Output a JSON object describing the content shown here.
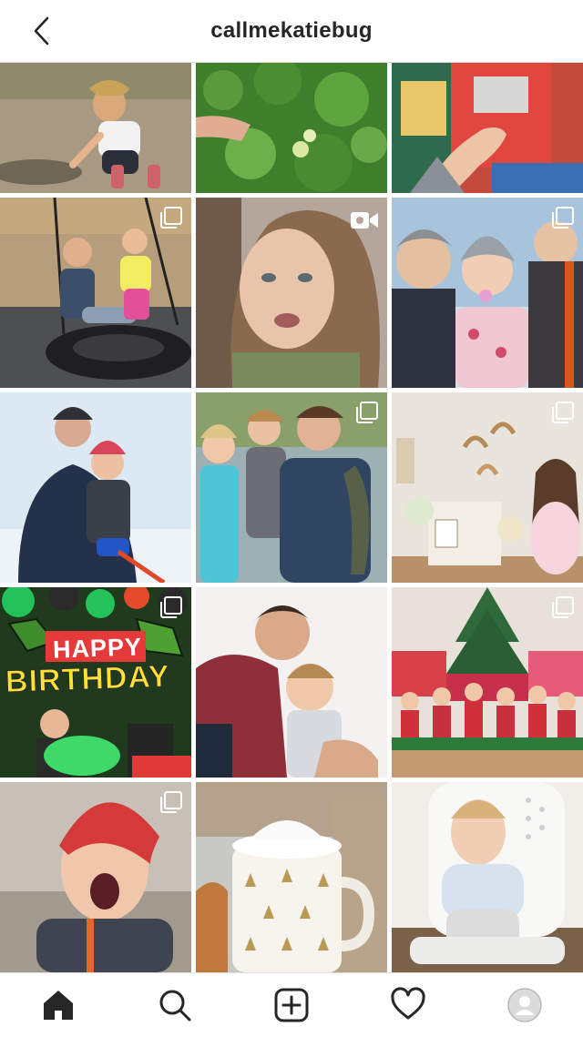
{
  "header": {
    "username": "callmekatiebug",
    "back_icon": "chevron-left-icon"
  },
  "grid": {
    "posts": [
      {
        "name": "post-child-puddle",
        "type": "photo"
      },
      {
        "name": "post-clover-field",
        "type": "photo"
      },
      {
        "name": "post-hand-present",
        "type": "photo"
      },
      {
        "name": "post-tire-swing",
        "type": "multi"
      },
      {
        "name": "post-mom-selfie-video",
        "type": "video"
      },
      {
        "name": "post-family-selfie",
        "type": "multi"
      },
      {
        "name": "post-dad-son-snow",
        "type": "photo"
      },
      {
        "name": "post-dad-kids-fish",
        "type": "multi"
      },
      {
        "name": "post-baby-shower",
        "type": "multi"
      },
      {
        "name": "post-birthday-party",
        "type": "multi"
      },
      {
        "name": "post-dad-hug-son",
        "type": "photo"
      },
      {
        "name": "post-christmas-kids",
        "type": "multi"
      },
      {
        "name": "post-boy-red-hat",
        "type": "multi"
      },
      {
        "name": "post-cocoa-mug",
        "type": "photo"
      },
      {
        "name": "post-toddler-chair",
        "type": "photo"
      }
    ],
    "birthday_sign": {
      "line1": "HAPPY",
      "line2": "BIRTHDAY"
    }
  },
  "bottom_nav": [
    {
      "name": "home",
      "icon": "home-icon"
    },
    {
      "name": "search",
      "icon": "search-icon"
    },
    {
      "name": "new-post",
      "icon": "add-post-icon"
    },
    {
      "name": "activity",
      "icon": "heart-icon"
    },
    {
      "name": "profile",
      "icon": "avatar-icon"
    }
  ],
  "colors": {
    "text": "#262626",
    "border": "#dbdbdb",
    "background": "#ffffff"
  }
}
